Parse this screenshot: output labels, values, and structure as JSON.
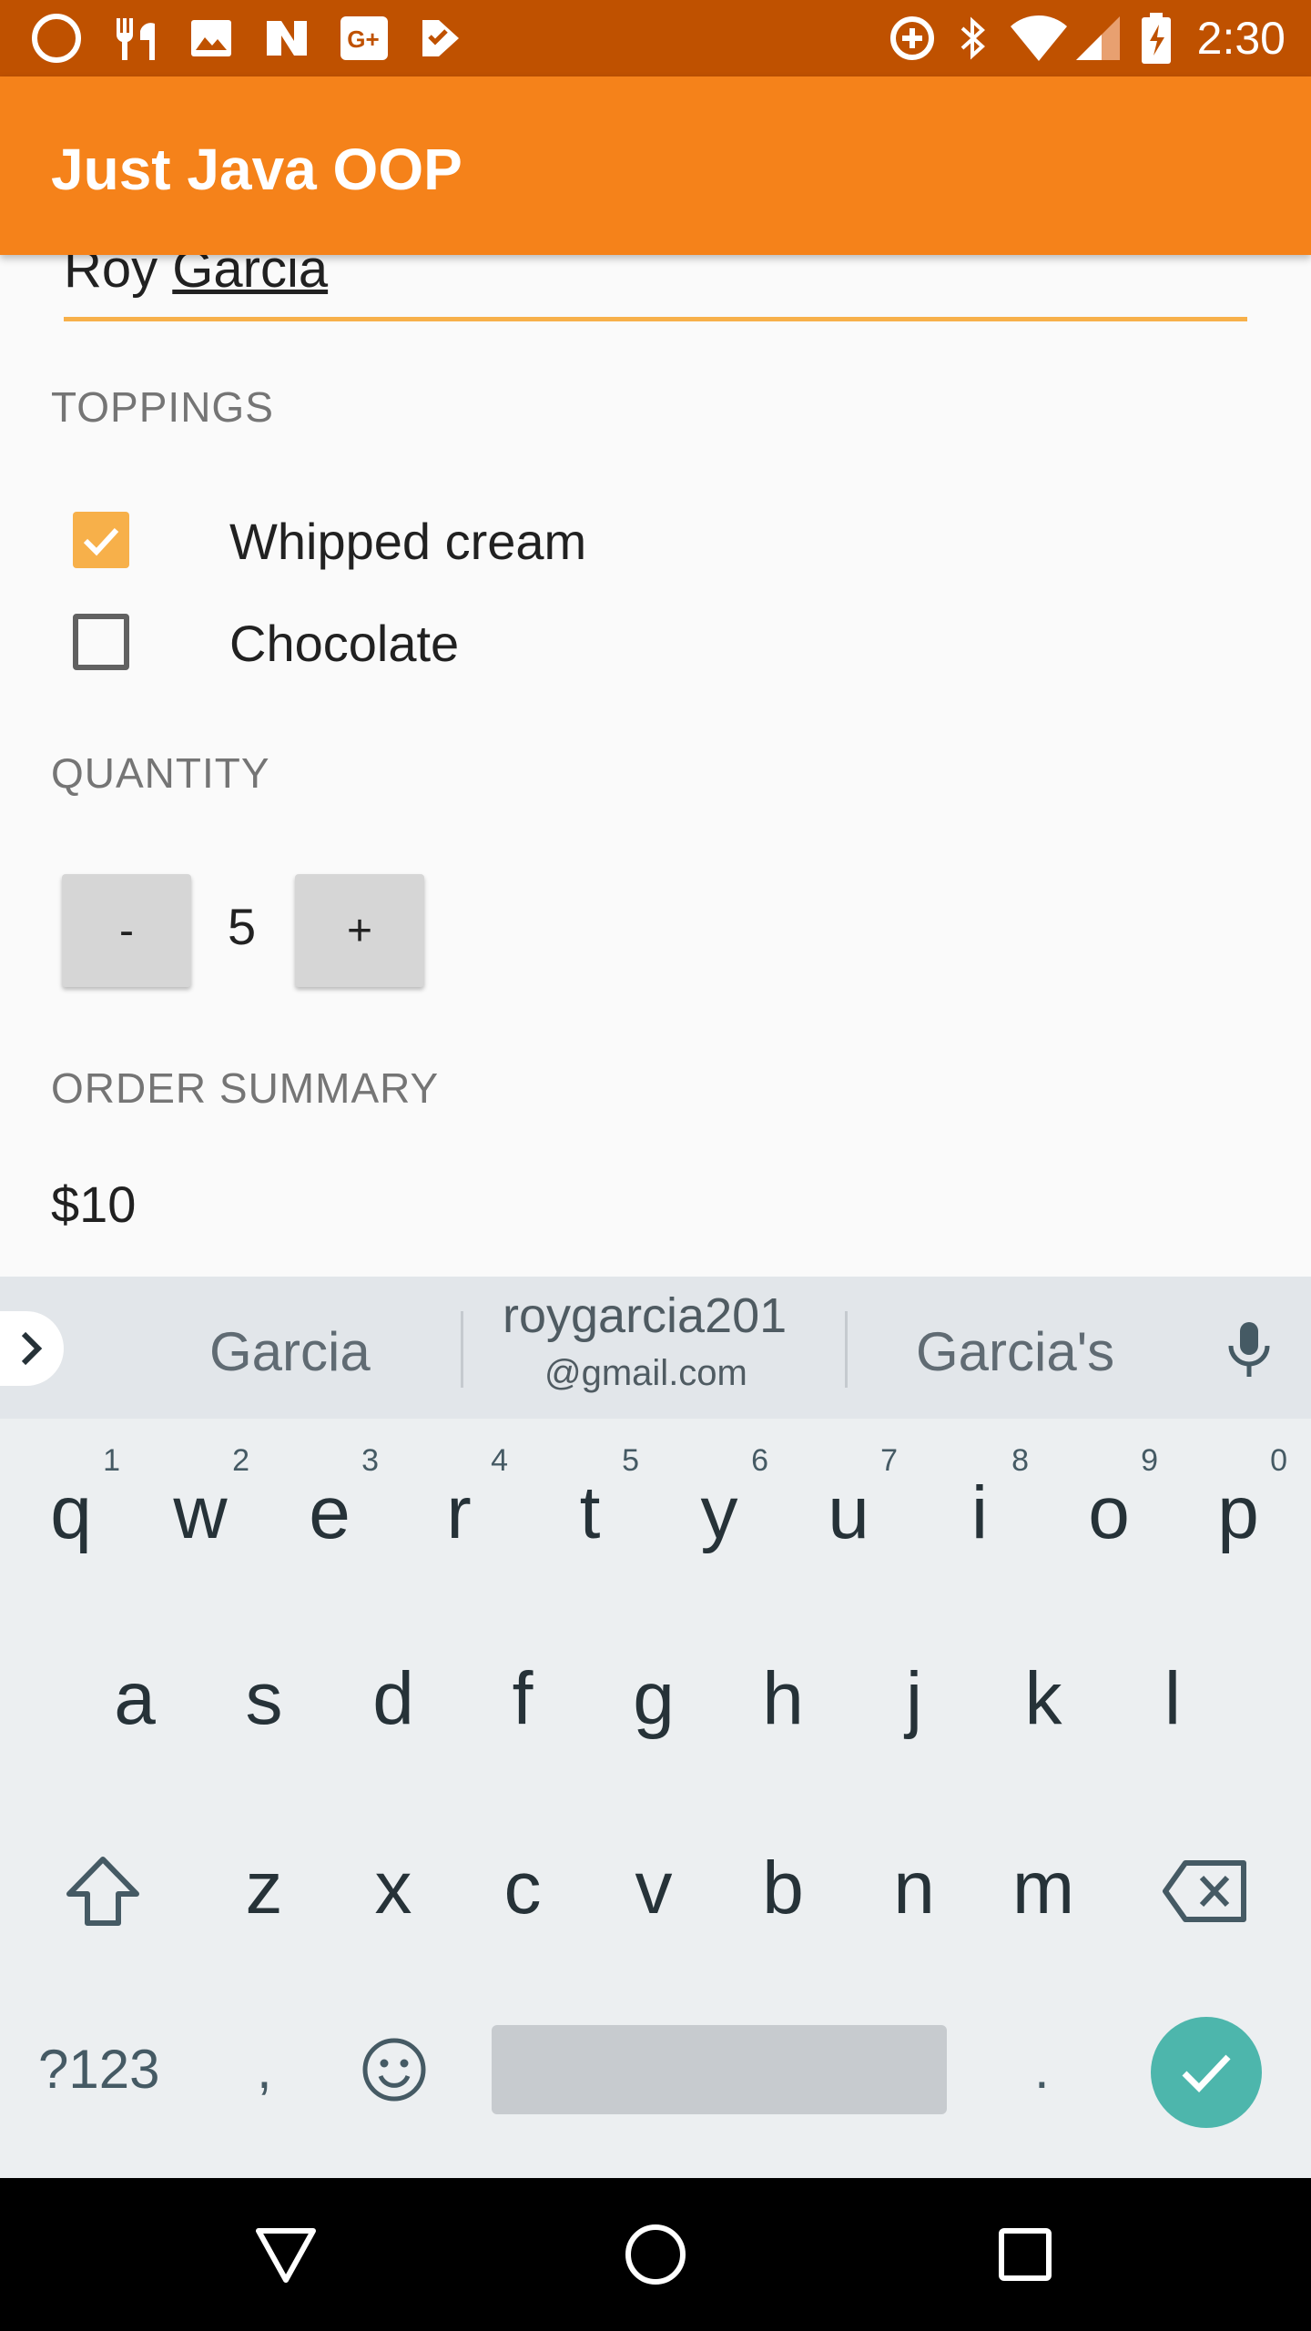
{
  "status_bar": {
    "time": "2:30",
    "left_icons": [
      "circle-icon",
      "restaurant-icon",
      "image-icon",
      "n-logo-icon",
      "google-plus-icon",
      "check-tag-icon"
    ],
    "right_icons": [
      "data-saver-icon",
      "bluetooth-icon",
      "wifi-icon",
      "cell-signal-icon",
      "battery-charging-icon"
    ]
  },
  "app_bar": {
    "title": "Just Java OOP"
  },
  "form": {
    "name_first": "Roy",
    "name_last": "Garcia",
    "toppings_label": "TOPPINGS",
    "toppings": [
      {
        "label": "Whipped cream",
        "checked": true
      },
      {
        "label": "Chocolate",
        "checked": false
      }
    ],
    "quantity_label": "QUANTITY",
    "decrement_label": "-",
    "quantity": "5",
    "increment_label": "+",
    "summary_label": "ORDER SUMMARY",
    "summary_value": "$10"
  },
  "keyboard": {
    "suggestions": {
      "left": "Garcia",
      "center_top": "roygarcia201",
      "center_bottom": "@gmail.com",
      "right": "Garcia's"
    },
    "row1": [
      {
        "k": "q",
        "h": "1"
      },
      {
        "k": "w",
        "h": "2"
      },
      {
        "k": "e",
        "h": "3"
      },
      {
        "k": "r",
        "h": "4"
      },
      {
        "k": "t",
        "h": "5"
      },
      {
        "k": "y",
        "h": "6"
      },
      {
        "k": "u",
        "h": "7"
      },
      {
        "k": "i",
        "h": "8"
      },
      {
        "k": "o",
        "h": "9"
      },
      {
        "k": "p",
        "h": "0"
      }
    ],
    "row2": [
      "a",
      "s",
      "d",
      "f",
      "g",
      "h",
      "j",
      "k",
      "l"
    ],
    "row3": [
      "z",
      "x",
      "c",
      "v",
      "b",
      "n",
      "m"
    ],
    "symbols_key": "?123",
    "comma_key": ",",
    "period_key": "."
  },
  "colors": {
    "status_bar": "#bf5100",
    "app_bar": "#f5821a",
    "accent": "#f7b04a",
    "enter": "#4db6ac"
  }
}
